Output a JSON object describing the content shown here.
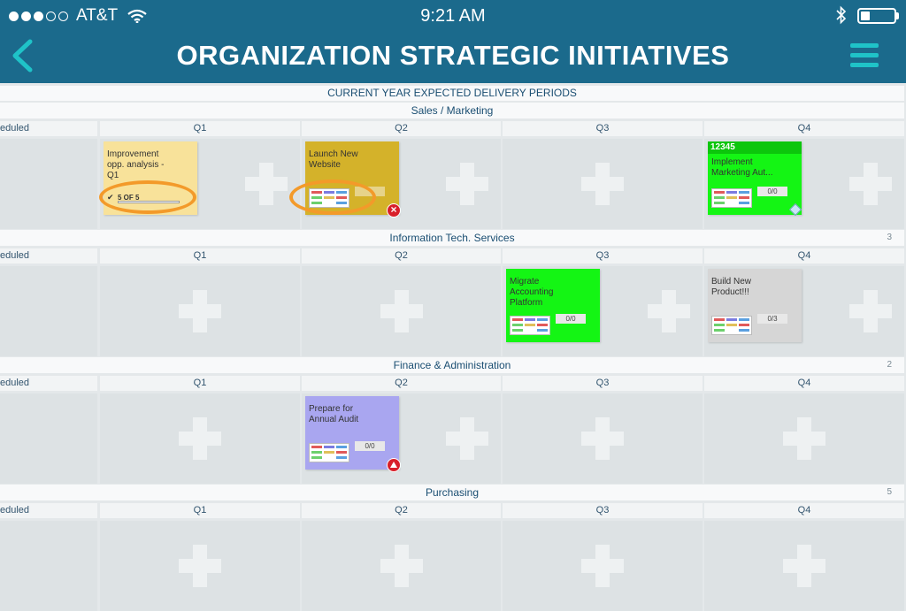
{
  "status_bar": {
    "carrier": "AT&T",
    "time": "9:21 AM",
    "signal_dots_filled": 3,
    "signal_dots_total": 5,
    "wifi_icon": "wifi-icon",
    "bluetooth_icon": "bluetooth-icon",
    "battery_level": 0.25
  },
  "header": {
    "title": "ORGANIZATION STRATEGIC INITIATIVES",
    "back_icon": "chevron-left-icon",
    "menu_icon": "hamburger-menu-icon",
    "background_color": "#1b6a8c",
    "accent_color": "#1fc3c8"
  },
  "board": {
    "banner": "CURRENT YEAR EXPECTED DELIVERY PERIODS",
    "unscheduled_label": "eduled",
    "columns": [
      "Q1",
      "Q2",
      "Q3",
      "Q4"
    ],
    "groups": [
      {
        "name": "Sales / Marketing",
        "count": "",
        "cards": {
          "q1": {
            "text": "Improvement\nopp. analysis -\nQ1",
            "progress_label": "5 OF 5",
            "progress_value": 1.0,
            "color": "#f8e29a"
          },
          "q2": {
            "text": "Launch New\nWebsite",
            "color": "#d4b22a",
            "status": "error-icon"
          },
          "q4": {
            "id": "12345",
            "text": "Implement\nMarketing Aut...",
            "ratio": "0/0",
            "color": "#14f514",
            "status": "tag-icon"
          }
        }
      },
      {
        "name": "Information Tech. Services",
        "count": "3",
        "cards": {
          "q3": {
            "text": "Migrate\nAccounting\nPlatform",
            "ratio": "0/0",
            "color": "#14f514"
          },
          "q4": {
            "text": "Build New\nProduct!!!",
            "ratio": "0/3",
            "color": "#d6d6d6"
          }
        }
      },
      {
        "name": "Finance & Administration",
        "count": "2",
        "cards": {
          "q2": {
            "text": "Prepare for\nAnnual Audit",
            "ratio": "0/0",
            "color": "#a9a6f0",
            "status": "warning-up-icon"
          }
        }
      },
      {
        "name": "Purchasing",
        "count": "5",
        "cards": {}
      }
    ]
  }
}
